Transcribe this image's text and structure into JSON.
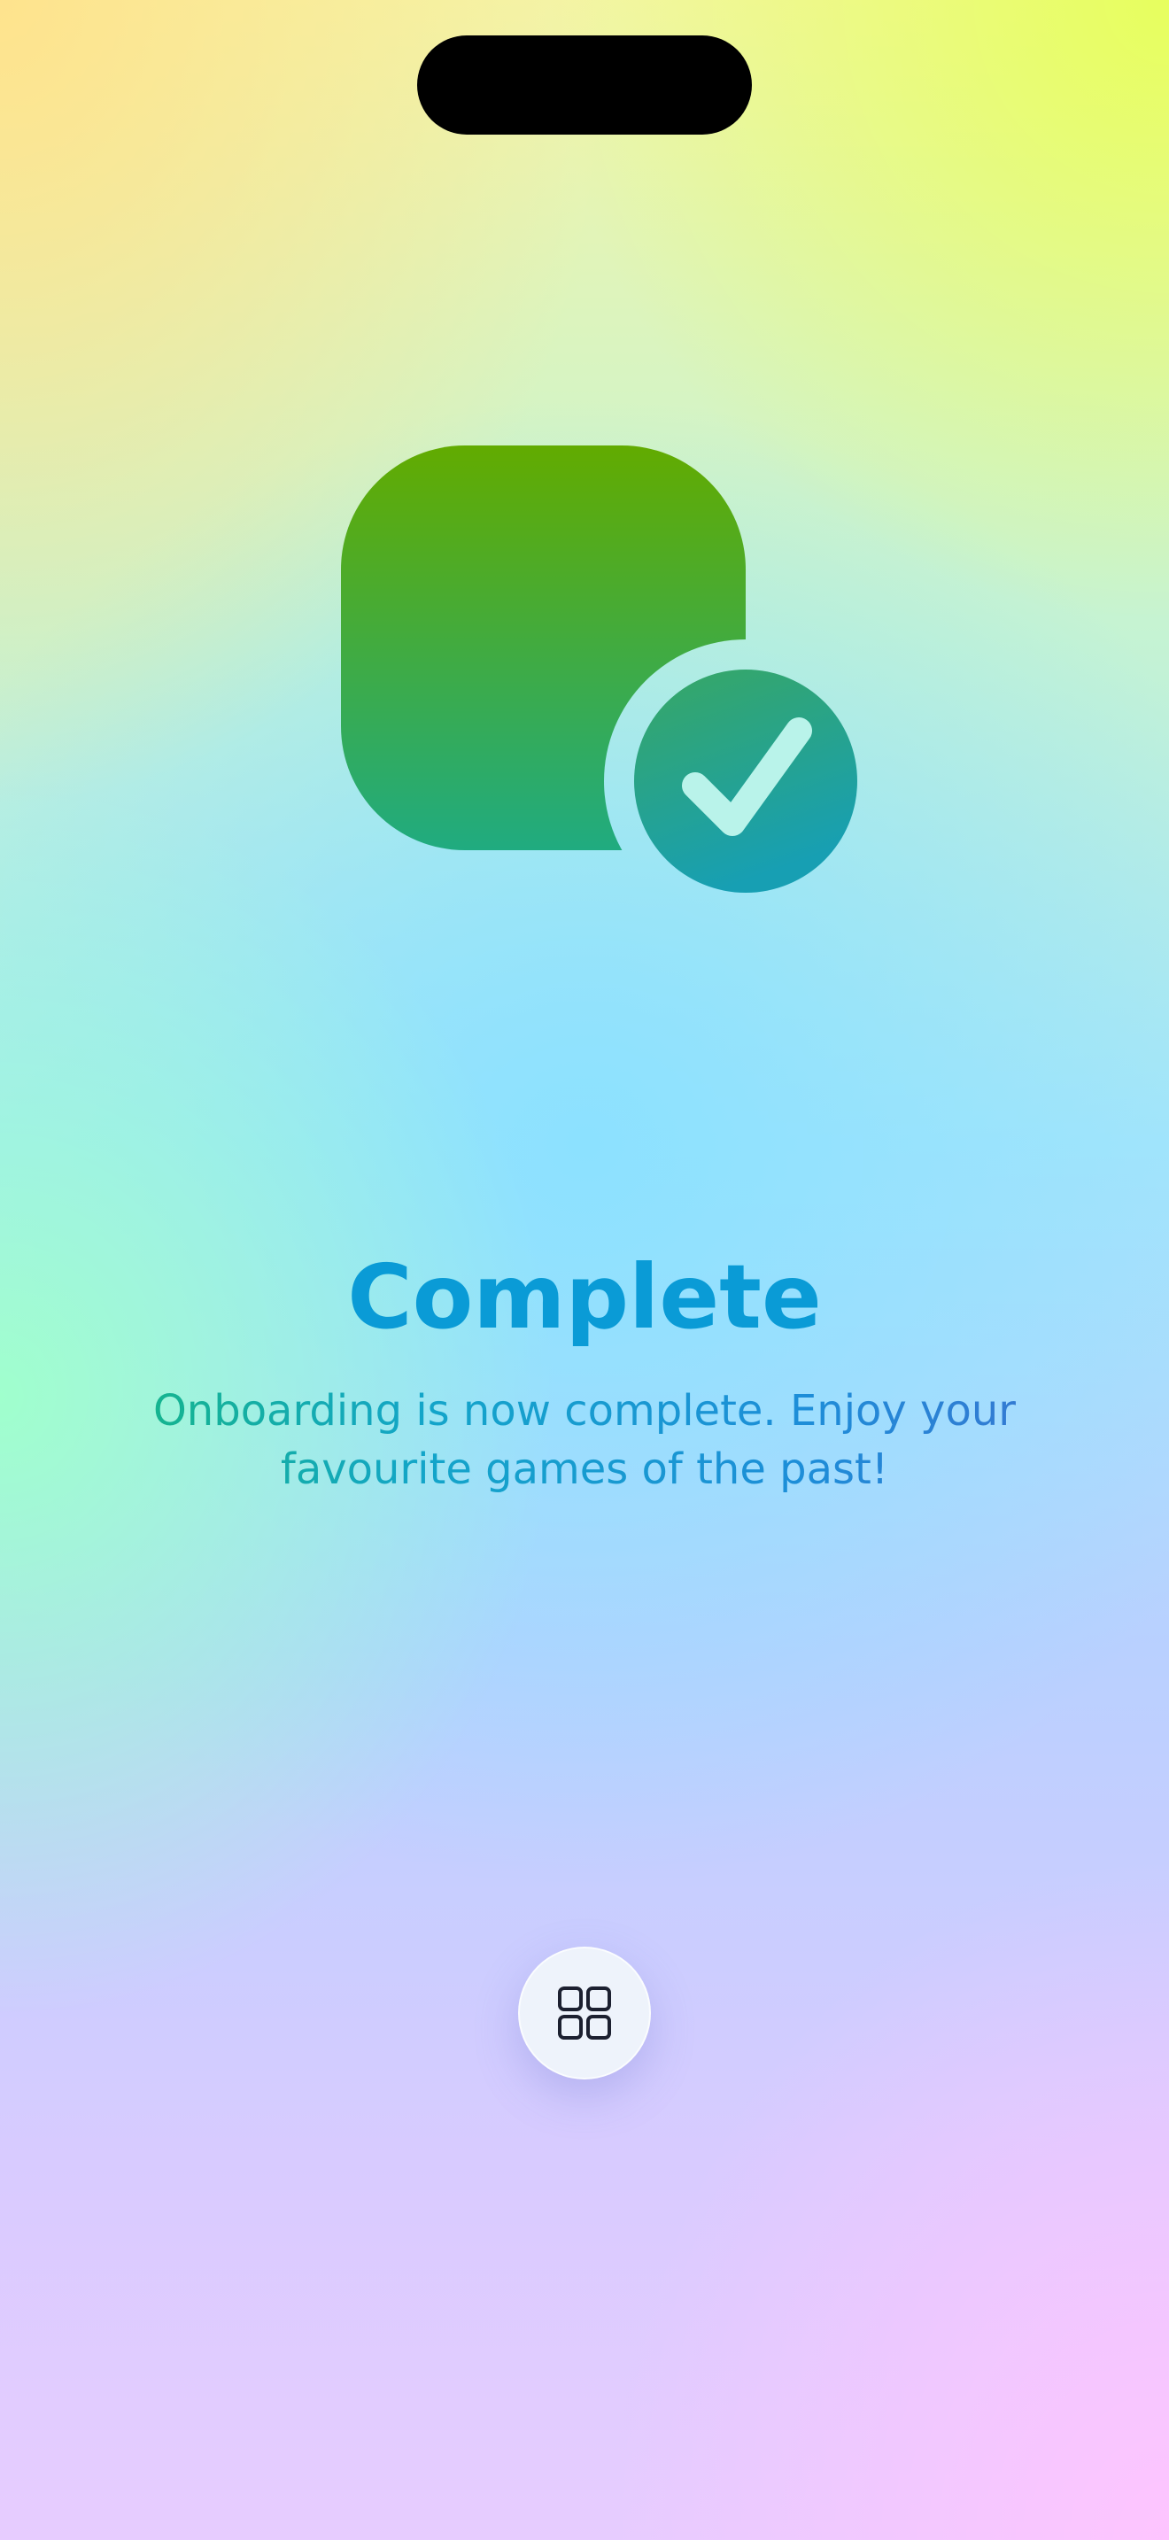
{
  "screen": {
    "title": "Complete",
    "message": "Onboarding is now complete. Enjoy your favourite games of the past!"
  },
  "hero": {
    "icon": "app-square-checkmark-icon",
    "colors": {
      "square_top": "#62ab00",
      "square_bottom": "#20ab80",
      "badge_top": "#38a763",
      "badge_bottom": "#179fb3",
      "checkmark": "#b9f3ea"
    }
  },
  "bottom_button": {
    "icon": "grid-icon"
  },
  "colors": {
    "title": "#0a9bd6",
    "subtitle_start": "#16b97a",
    "subtitle_end": "#3d72d0"
  }
}
